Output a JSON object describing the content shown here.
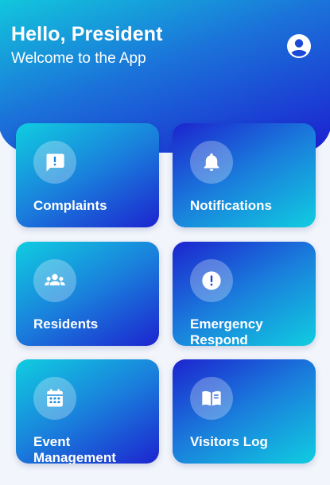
{
  "header": {
    "greeting": "Hello, President",
    "subtitle": "Welcome to the App",
    "profile_icon": "account-circle-icon"
  },
  "menu": [
    {
      "label": "Complaints",
      "icon": "feedback-icon"
    },
    {
      "label": "Notifications",
      "icon": "bell-icon"
    },
    {
      "label": "Residents",
      "icon": "people-icon"
    },
    {
      "label": "Emergency Respond",
      "icon": "alert-circle-icon"
    },
    {
      "label": "Event Management",
      "icon": "calendar-icon"
    },
    {
      "label": "Visitors Log",
      "icon": "book-icon"
    }
  ],
  "colors": {
    "gradient_cyan": "#10cde0",
    "gradient_mid": "#1a7fdc",
    "gradient_blue": "#1c24cf",
    "background": "#f2f5fb",
    "text": "#ffffff"
  }
}
